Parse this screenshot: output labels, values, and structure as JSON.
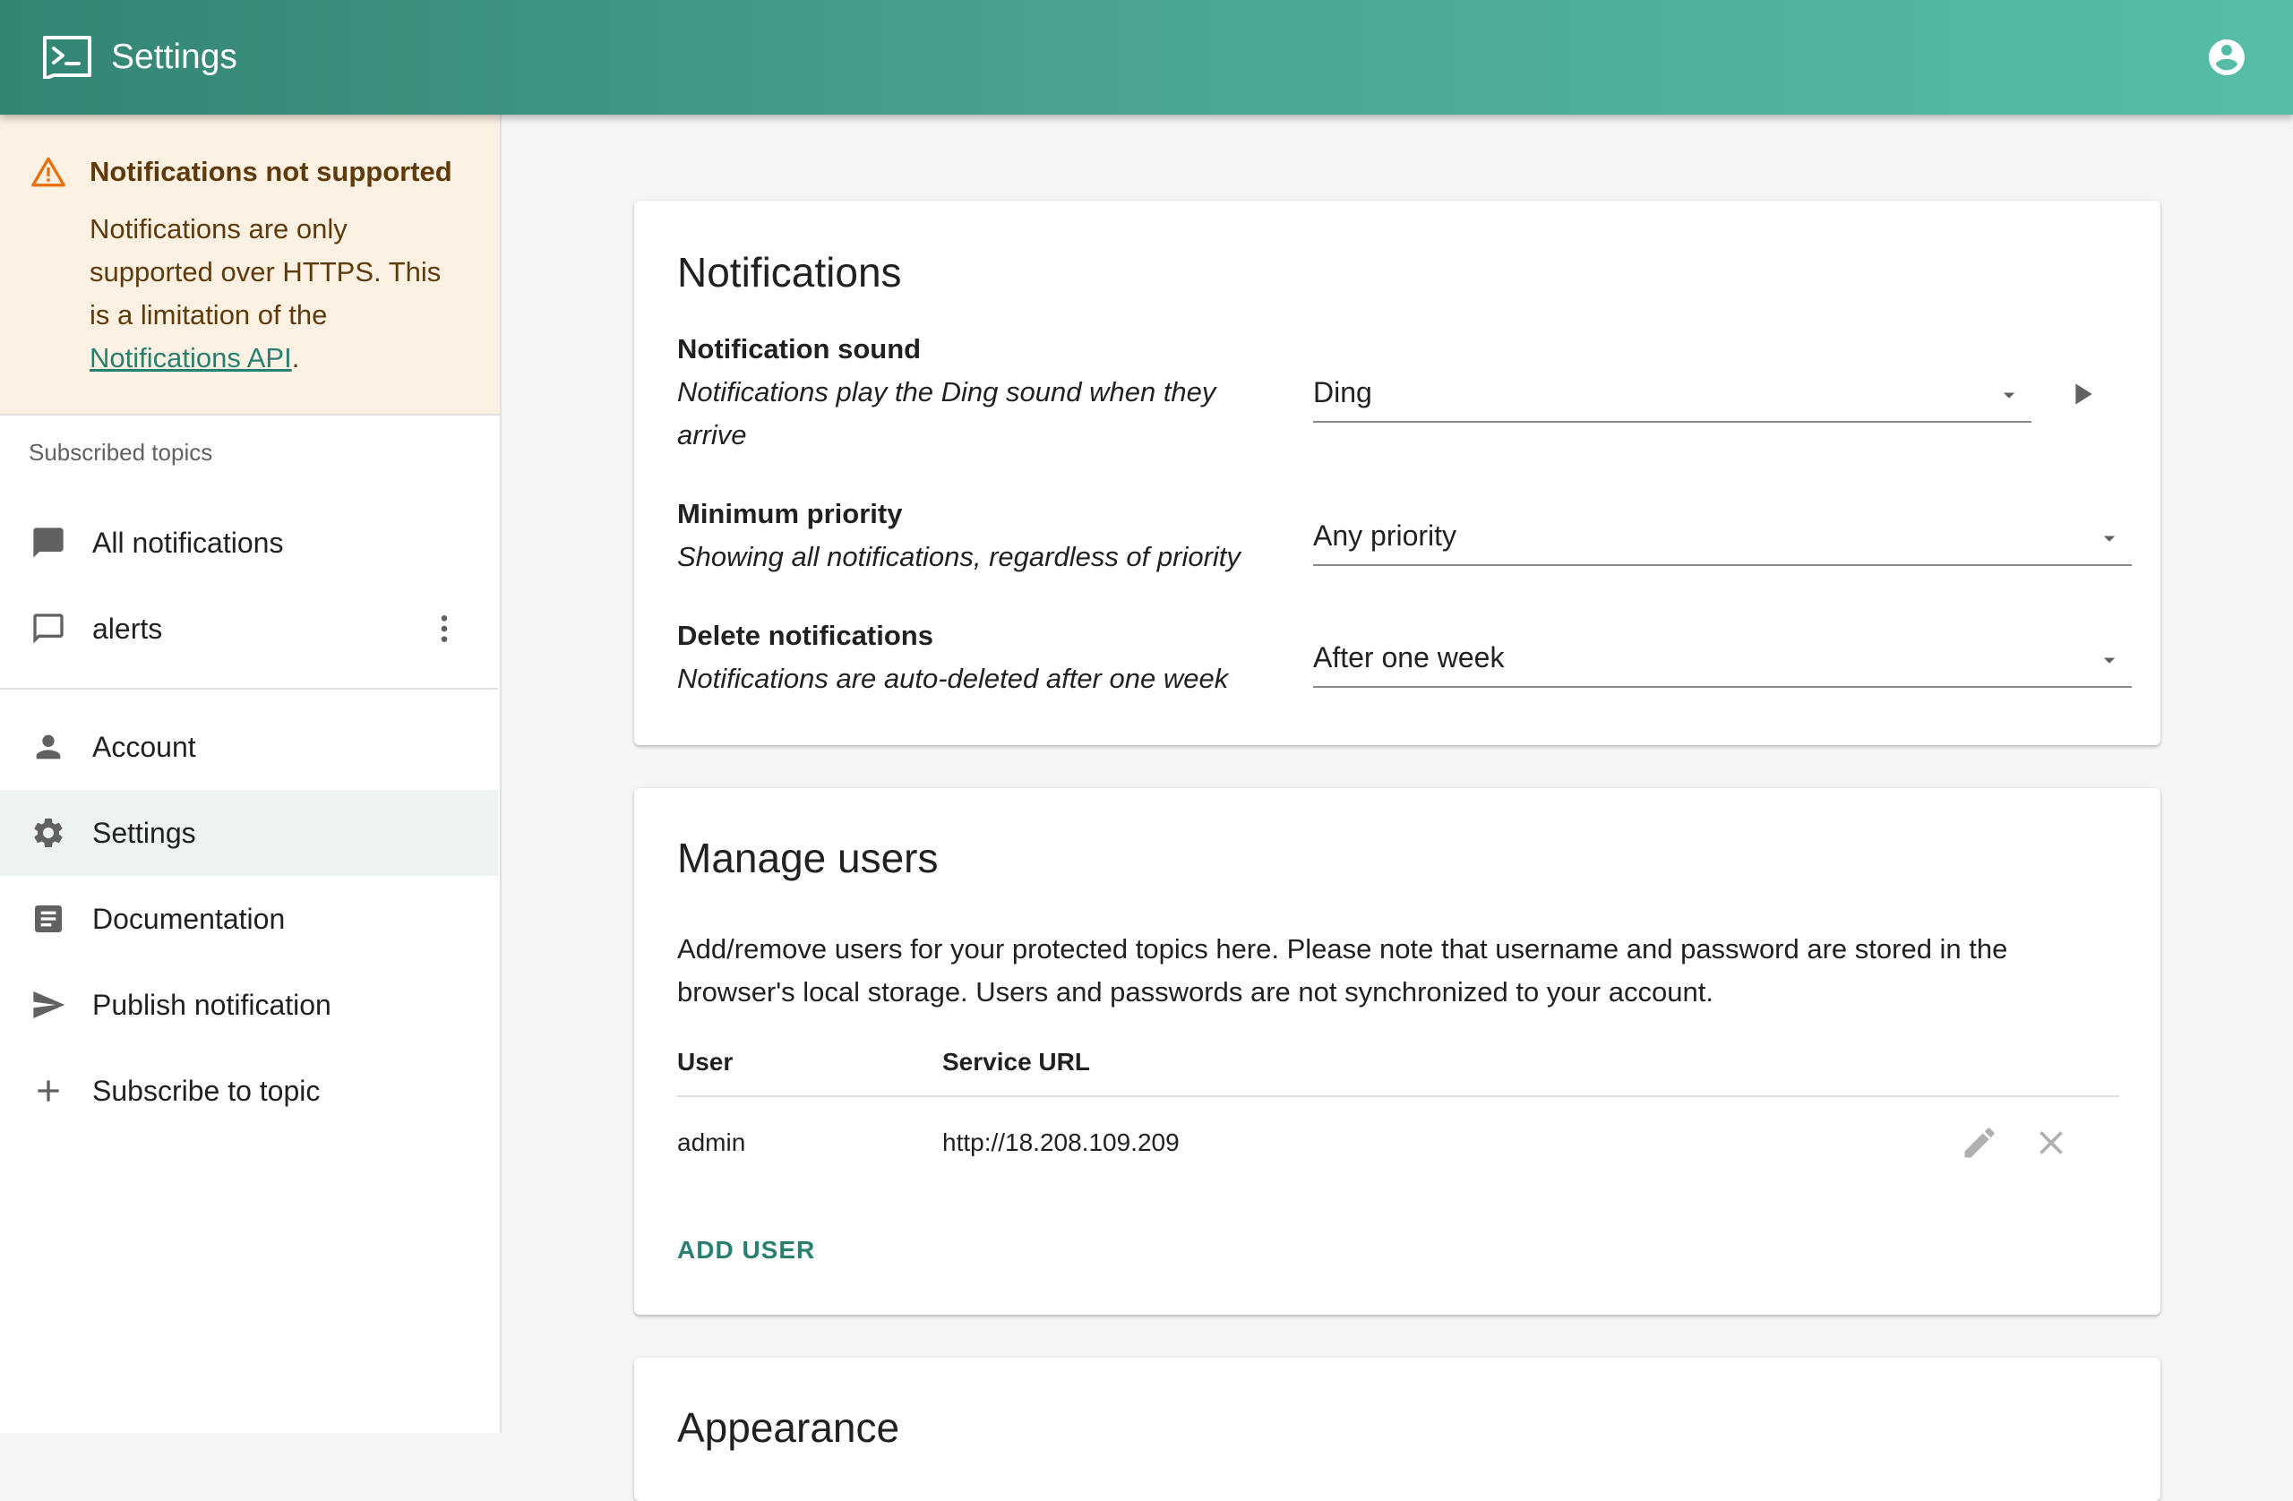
{
  "app": {
    "title": "Settings"
  },
  "alert": {
    "title": "Notifications not supported",
    "body": "Notifications are only supported over HTTPS. This is a limitation of the ",
    "link": "Notifications API",
    "suffix": "."
  },
  "sidebar": {
    "section_header": "Subscribed topics",
    "topics": [
      {
        "label": "All notifications",
        "icon": "chat-filled-icon"
      },
      {
        "label": "alerts",
        "icon": "chat-outline-icon"
      }
    ],
    "items": [
      {
        "label": "Account",
        "icon": "person-icon"
      },
      {
        "label": "Settings",
        "icon": "gear-icon",
        "active": true
      },
      {
        "label": "Documentation",
        "icon": "article-icon"
      },
      {
        "label": "Publish notification",
        "icon": "send-icon"
      },
      {
        "label": "Subscribe to topic",
        "icon": "plus-icon"
      }
    ]
  },
  "notifications_card": {
    "title": "Notifications",
    "sound": {
      "title": "Notification sound",
      "desc": "Notifications play the Ding sound when they arrive",
      "value": "Ding"
    },
    "priority": {
      "title": "Minimum priority",
      "desc": "Showing all notifications, regardless of priority",
      "value": "Any priority"
    },
    "delete": {
      "title": "Delete notifications",
      "desc": "Notifications are auto-deleted after one week",
      "value": "After one week"
    }
  },
  "users_card": {
    "title": "Manage users",
    "description": "Add/remove users for your protected topics here. Please note that username and password are stored in the browser's local storage. Users and passwords are not synchronized to your account.",
    "columns": [
      "User",
      "Service URL"
    ],
    "rows": [
      {
        "user": "admin",
        "url": "http://18.208.109.209"
      }
    ],
    "add_button": "ADD USER"
  },
  "appearance_card": {
    "title": "Appearance"
  },
  "colors": {
    "accent": "#338574",
    "alert_bg": "#fdf1e3",
    "alert_icon": "#ed6c02",
    "link": "#2a8070"
  }
}
